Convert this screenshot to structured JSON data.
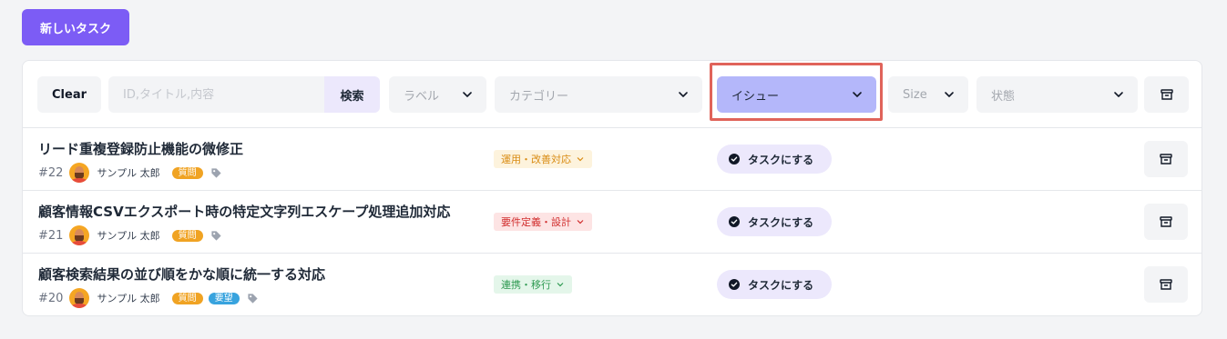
{
  "header": {
    "new_task_label": "新しいタスク"
  },
  "filters": {
    "clear_label": "Clear",
    "search_placeholder": "ID,タイトル,内容",
    "search_button_label": "検索",
    "label_select": "ラベル",
    "category_select": "カテゴリー",
    "issue_select": "イシュー",
    "size_select": "Size",
    "status_select": "状態"
  },
  "colors": {
    "accent": "#7c5cf5",
    "highlight": "#e0635a"
  },
  "tasks": [
    {
      "title": "リード重複登録防止機能の微修正",
      "id": "#22",
      "user": "サンプル 太郎",
      "tags": [
        "質問"
      ],
      "category": "運用・改善対応",
      "action": "タスクにする"
    },
    {
      "title": "顧客情報CSVエクスポート時の特定文字列エスケープ処理追加対応",
      "id": "#21",
      "user": "サンプル 太郎",
      "tags": [
        "質問"
      ],
      "category": "要件定義・設計",
      "action": "タスクにする"
    },
    {
      "title": "顧客検索結果の並び順をかな順に統一する対応",
      "id": "#20",
      "user": "サンプル 太郎",
      "tags": [
        "質問",
        "要望"
      ],
      "category": "連携・移行",
      "action": "タスクにする"
    }
  ]
}
